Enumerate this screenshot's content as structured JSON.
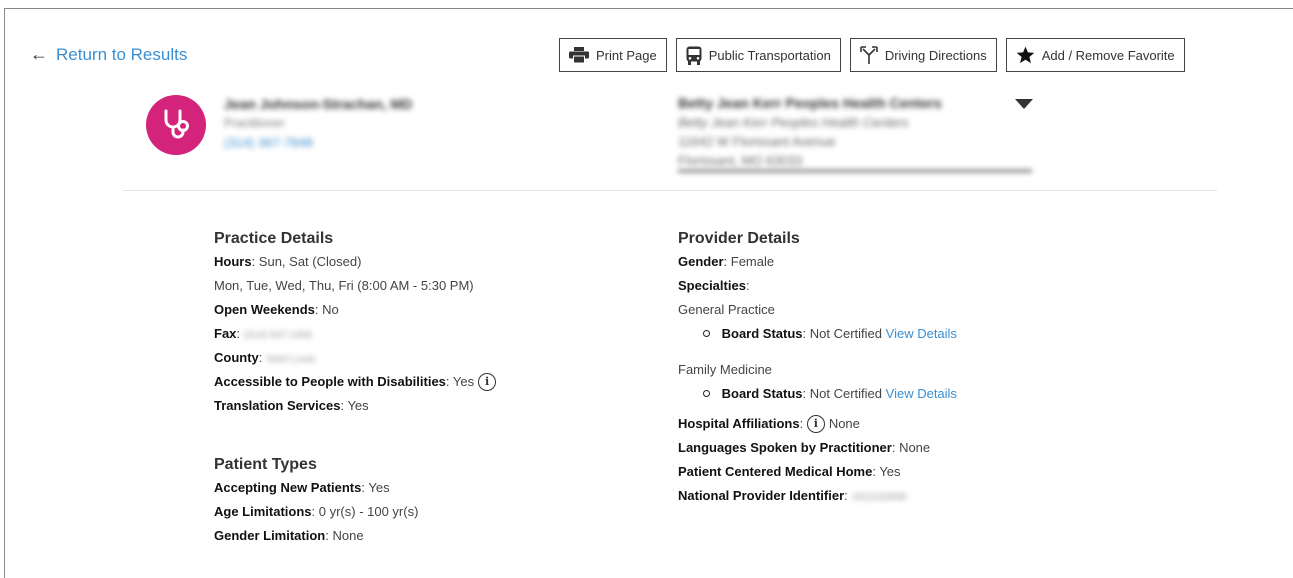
{
  "nav": {
    "back_label": "Return to Results",
    "back_arrow": "←"
  },
  "toolbar": {
    "print": "Print Page",
    "transit": "Public Transportation",
    "driving": "Driving Directions",
    "favorite": "Add / Remove Favorite"
  },
  "provider": {
    "name": "Jean Johnson-Strachan, MD",
    "role": "Practitioner",
    "phone": "(314) 367-7848",
    "avatar_icon": "stethoscope-icon",
    "avatar_color": "#d4237a"
  },
  "location": {
    "name": "Betty Jean Kerr Peoples Health Centers",
    "subtitle": "Betty Jean Kerr Peoples Health Centers",
    "address1": "11642 W Florissant Avenue",
    "address2": "Florissant, MO 63033"
  },
  "practice": {
    "heading": "Practice Details",
    "hours_label": "Hours",
    "hours_value": "Sun, Sat (Closed)",
    "hours_line2": "Mon, Tue, Wed, Thu, Fri (8:00 AM - 5:30 PM)",
    "weekends_label": "Open Weekends",
    "weekends_value": "No",
    "fax_label": "Fax",
    "fax_value": "(314) 837-1406",
    "county_label": "County",
    "county_value": "Saint Louis",
    "accessible_label": "Accessible to People with Disabilities",
    "accessible_value": "Yes",
    "translation_label": "Translation Services",
    "translation_value": "Yes"
  },
  "patients": {
    "heading": "Patient Types",
    "accepting_label": "Accepting New Patients",
    "accepting_value": "Yes",
    "age_label": "Age Limitations",
    "age_value": "0 yr(s) - 100 yr(s)",
    "gender_label": "Gender Limitation",
    "gender_value": "None"
  },
  "provider_details": {
    "heading": "Provider Details",
    "gender_label": "Gender",
    "gender_value": "Female",
    "specialties_label": "Specialties",
    "specialties": [
      {
        "name": "General Practice",
        "board_label": "Board Status",
        "board_value": "Not Certified",
        "link": "View Details"
      },
      {
        "name": "Family Medicine",
        "board_label": "Board Status",
        "board_value": "Not Certified",
        "link": "View Details"
      }
    ],
    "hospital_label": "Hospital Affiliations",
    "hospital_value": "None",
    "languages_label": "Languages Spoken by Practitioner",
    "languages_value": "None",
    "pcmh_label": "Patient Centered Medical Home",
    "pcmh_value": "Yes",
    "npi_label": "National Provider Identifier",
    "npi_value": "1811032898"
  },
  "colors": {
    "link": "#3b8fd1",
    "avatar": "#d4237a"
  }
}
